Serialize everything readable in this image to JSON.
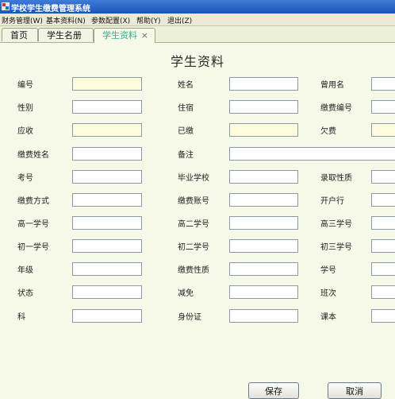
{
  "window": {
    "title": "学校学生缴费管理系统"
  },
  "menu": [
    "财务管理(W)",
    "基本资料(N)",
    "参数配置(X)",
    "帮助(Y)",
    "退出(Z)"
  ],
  "tabs": [
    "首页",
    "学生名册",
    "学生资料"
  ],
  "tab_close": "×",
  "page_title": "学生资料",
  "fields": {
    "id": "编号",
    "name": "姓名",
    "former_name": "曾用名",
    "gender": "性别",
    "lodging": "住宿",
    "payment_no": "缴费编号",
    "receivable": "应收",
    "paid": "已缴",
    "arrears": "欠费",
    "payer_name": "缴费姓名",
    "remark": "备注",
    "exam_no": "考号",
    "graduated_school": "毕业学校",
    "admission_type": "录取性质",
    "payment_method": "缴费方式",
    "payment_account": "缴费账号",
    "bank": "开户行",
    "g10_no": "高一学号",
    "g11_no": "高二学号",
    "g12_no": "高三学号",
    "g7_no": "初一学号",
    "g8_no": "初二学号",
    "g9_no": "初三学号",
    "grade": "年级",
    "payment_type": "缴费性质",
    "student_no": "学号",
    "status": "状态",
    "reduction": "减免",
    "class": "班次",
    "subject": "科",
    "id_card": "身份证",
    "textbook": "课本"
  },
  "buttons": {
    "save": "保存",
    "cancel": "取消"
  },
  "colors": {
    "highlight_field": "#fffbdd",
    "active_tab_text": "#3aa88a",
    "titlebar": "#1c55b8"
  }
}
